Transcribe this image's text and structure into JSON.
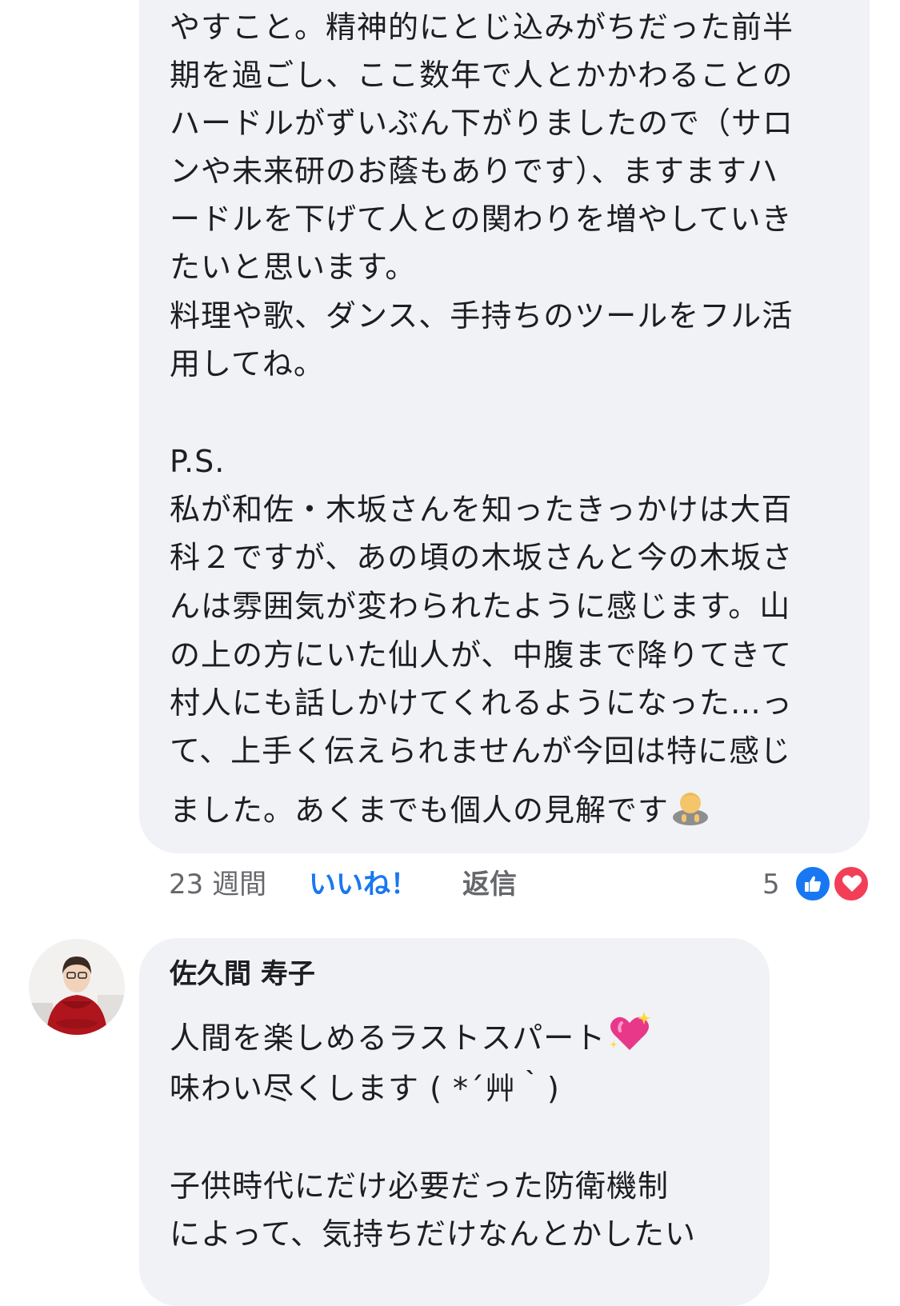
{
  "comment1": {
    "lines": [
      "やすこと。精神的にとじ込みがちだった前半",
      "期を過ごし、ここ数年で人とかかわることの",
      "ハードルがずいぶん下がりましたので（サロ",
      "ンや未来研のお蔭もありです）、ますますハ",
      "ードルを下げて人との関わりを増やしていき",
      "たいと思います。",
      "料理や歌、ダンス、手持ちのツールをフル活",
      "用してね。",
      "",
      "P.S.",
      "私が和佐・木坂さんを知ったきっかけは大百",
      "科２ですが、あの頃の木坂さんと今の木坂さ",
      "んは雰囲気が変わられたように感じます。山",
      "の上の方にいた仙人が、中腹まで降りてきて",
      "村人にも話しかけてくれるようになった…っ",
      "て、上手く伝えられませんが今回は特に感じ"
    ],
    "last_line": "ました。あくまでも個人の見解です",
    "last_emoji": "🙇",
    "time": "23 週間",
    "like_label": "いいね！",
    "reply_label": "返信",
    "reaction_count": "5",
    "reactions": [
      "like-icon",
      "love-icon"
    ],
    "colors": {
      "like": "#1877f2",
      "love": "#f33e58",
      "meta": "#65676b",
      "bubble": "#f0f2f5"
    }
  },
  "comment2": {
    "author": "佐久間 寿子",
    "line1": "人間を楽しめるラストスパート",
    "line1_emoji": "💖",
    "line2": "味わい尽くします ( *´艸｀)",
    "line3": "子供時代にだけ必要だった防衛機制",
    "line4": "によって、気持ちだけなんとかしたい"
  }
}
